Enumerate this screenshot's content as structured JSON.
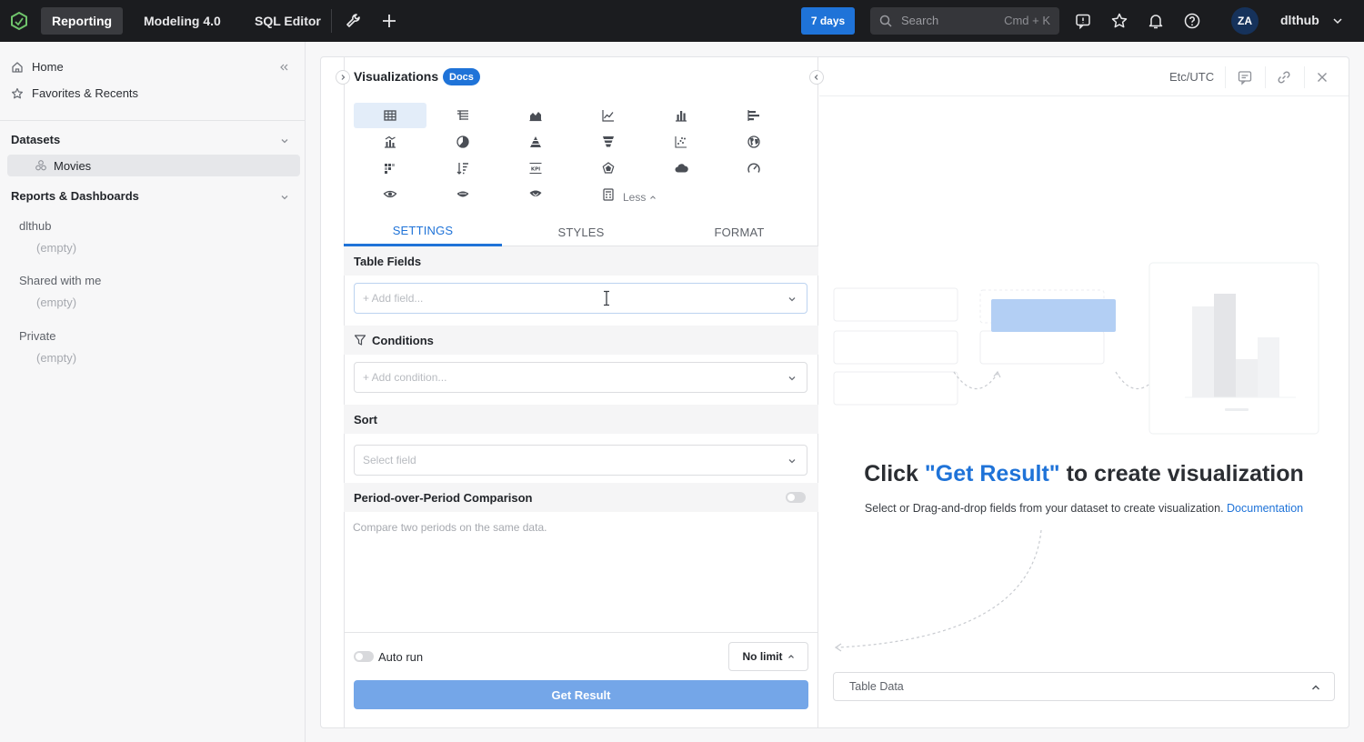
{
  "topbar": {
    "tabs": [
      {
        "label": "Reporting",
        "active": true
      },
      {
        "label": "Modeling 4.0",
        "active": false
      },
      {
        "label": "SQL Editor",
        "active": false
      }
    ],
    "days_label": "7 days",
    "search": {
      "placeholder": "Search",
      "shortcut": "Cmd + K"
    },
    "avatar_initials": "ZA",
    "username": "dlthub",
    "icons": [
      "logo-icon",
      "wrench-icon",
      "plus-icon",
      "search-icon",
      "feedback-icon",
      "star-icon",
      "bell-icon",
      "help-icon",
      "chevron-down-icon"
    ]
  },
  "sidebar": {
    "home": "Home",
    "favorites": "Favorites & Recents",
    "datasets_title": "Datasets",
    "dataset_item": "Movies",
    "reports_title": "Reports & Dashboards",
    "groups": [
      {
        "name": "dlthub",
        "empty": "(empty)"
      },
      {
        "name": "Shared with me",
        "empty": "(empty)"
      },
      {
        "name": "Private",
        "empty": "(empty)"
      }
    ]
  },
  "panel": {
    "title": "Visualizations",
    "docs_badge": "Docs",
    "viz_types": [
      "table",
      "pivot-table",
      "area",
      "line",
      "bar",
      "horizontal-bar",
      "combo",
      "pie",
      "pyramid",
      "funnel",
      "scatter",
      "map",
      "heatmap",
      "sorted-bar",
      "kpi",
      "radar",
      "word-cloud",
      "gauge",
      "retention-1",
      "retention-2",
      "retention-3",
      "metric-sheet"
    ],
    "less_label": "Less",
    "tabs": [
      "SETTINGS",
      "STYLES",
      "FORMAT"
    ],
    "table_fields": {
      "title": "Table Fields",
      "placeholder": "+ Add field..."
    },
    "conditions": {
      "title": "Conditions",
      "placeholder": "+ Add condition..."
    },
    "sort": {
      "title": "Sort",
      "placeholder": "Select field"
    },
    "pop": {
      "title": "Period-over-Period Comparison",
      "hint": "Compare two periods on the same data."
    },
    "auto_run_label": "Auto run",
    "limit_label": "No limit",
    "get_result_label": "Get Result"
  },
  "result": {
    "timezone": "Etc/UTC",
    "cta_prefix": "Click ",
    "cta_highlight": "\"Get Result\"",
    "cta_suffix": " to create visualization",
    "sub_text": "Select or Drag-and-drop fields from your dataset to create visualization. ",
    "sub_link": "Documentation",
    "table_data_label": "Table Data"
  },
  "colors": {
    "accent": "#1f73d8",
    "topbar": "#1b1c1f",
    "button_disabled": "#74a6e8"
  }
}
